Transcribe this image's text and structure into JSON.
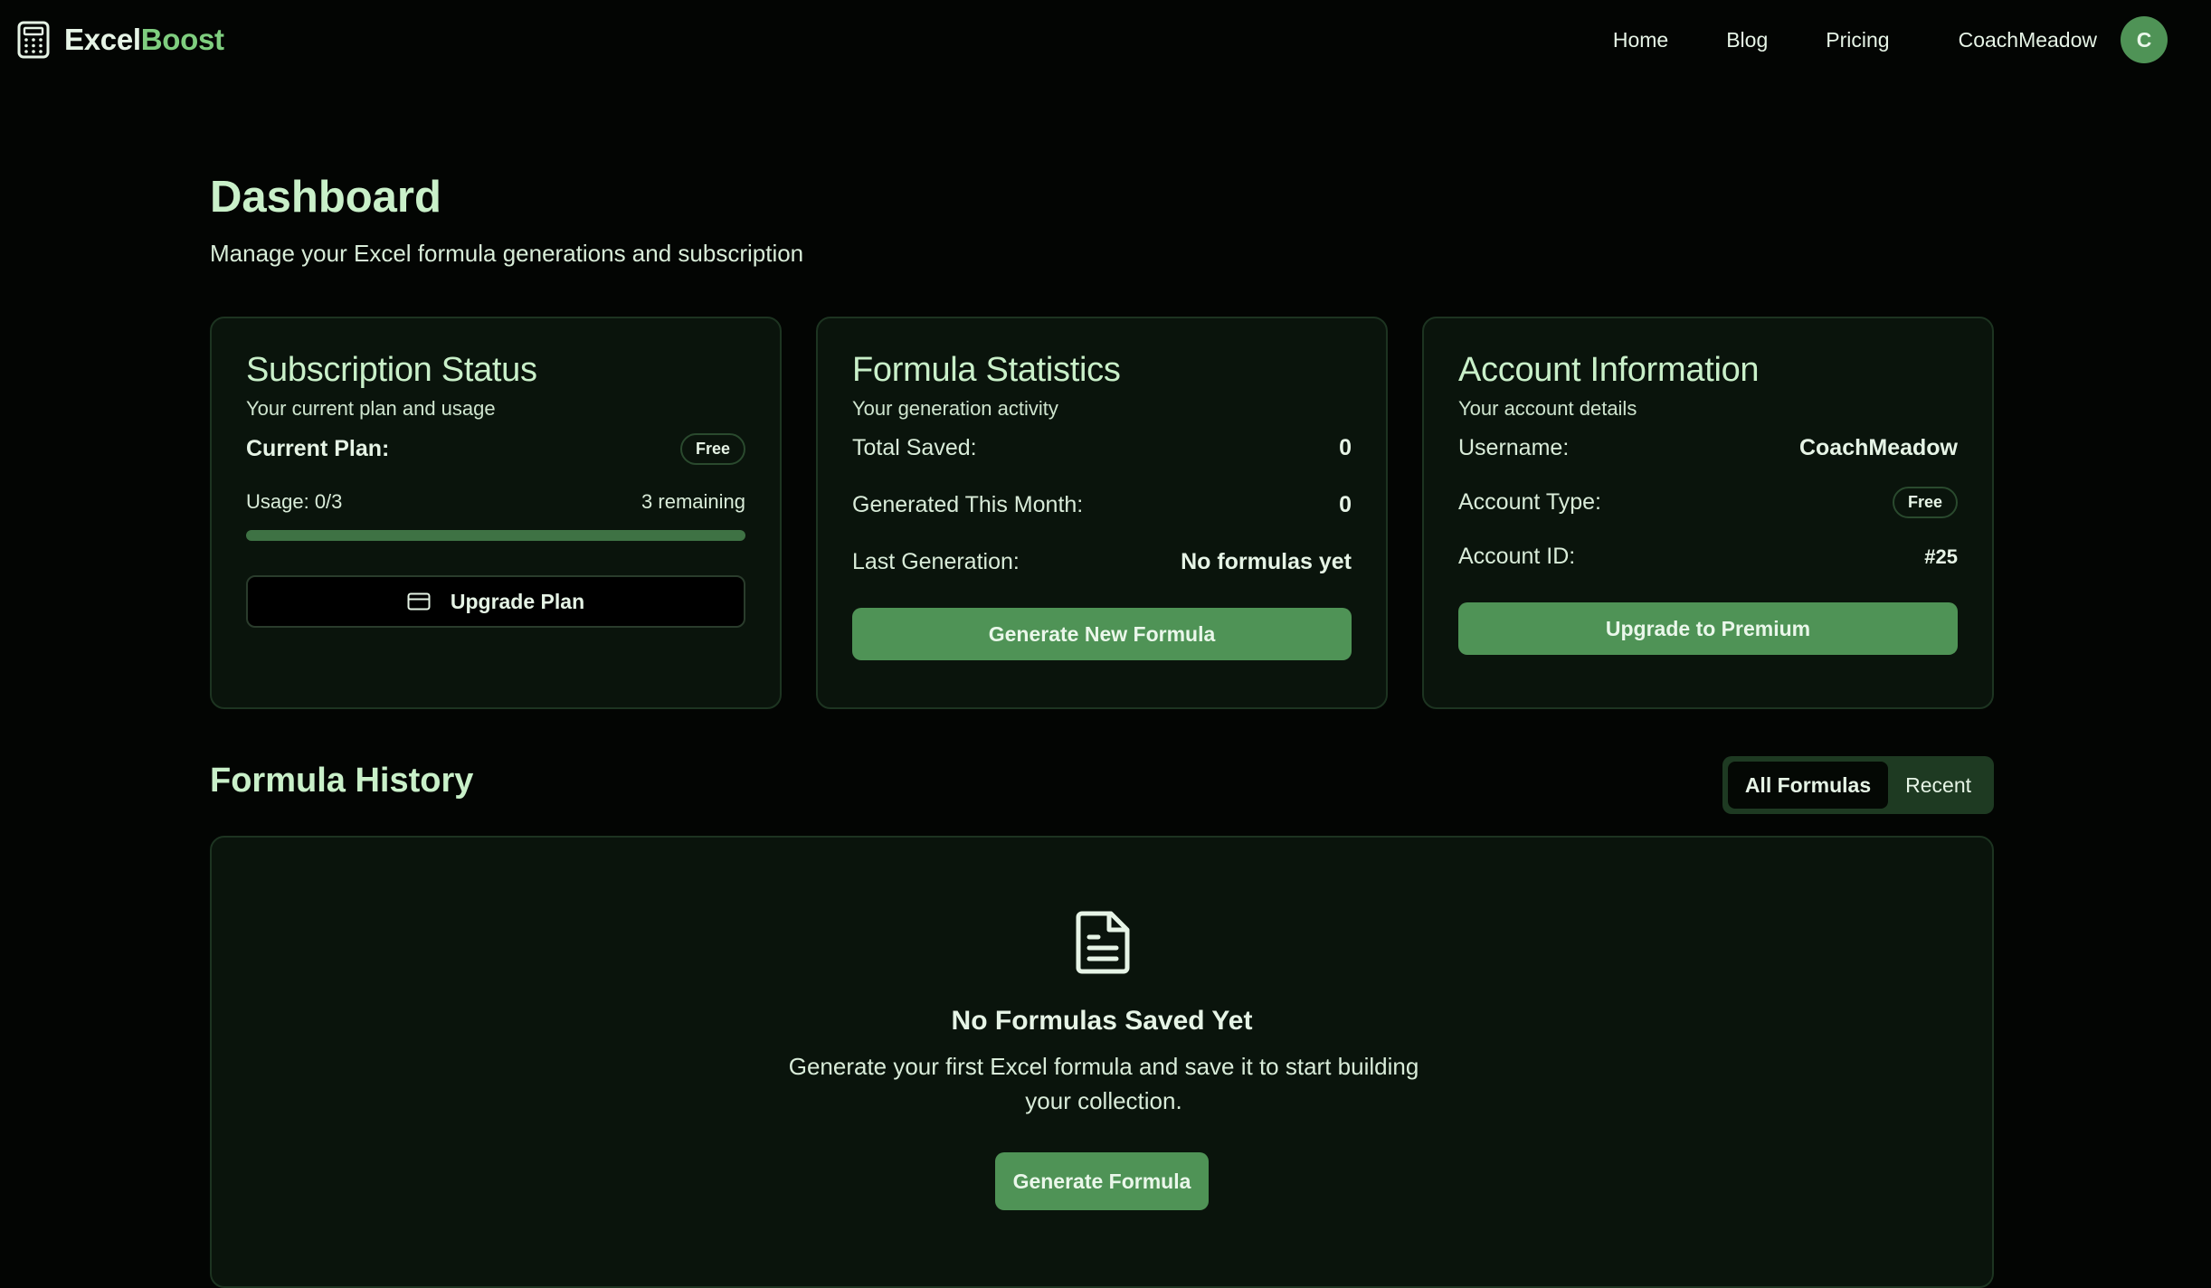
{
  "navbar": {
    "brand_part1": "Excel",
    "brand_part2": "Boost",
    "brand_icon": "calculator-icon",
    "links": [
      "Home",
      "Blog",
      "Pricing"
    ],
    "username": "CoachMeadow",
    "avatar_initial": "C"
  },
  "page": {
    "title": "Dashboard",
    "subtitle": "Manage your Excel formula generations and subscription"
  },
  "subscription": {
    "title": "Subscription Status",
    "description": "Your current plan and usage",
    "plan_label": "Current Plan:",
    "plan_value": "Free",
    "usage_label": "Usage: 0/3",
    "remaining": "3 remaining",
    "usage_fraction": 0,
    "upgrade_button": "Upgrade Plan",
    "upgrade_icon": "credit-card-icon"
  },
  "stats": {
    "title": "Formula Statistics",
    "description": "Your generation activity",
    "rows": [
      {
        "label": "Total Saved:",
        "value": "0"
      },
      {
        "label": "Generated This Month:",
        "value": "0"
      },
      {
        "label": "Last Generation:",
        "value": "No formulas yet"
      }
    ],
    "button": "Generate New Formula"
  },
  "account": {
    "title": "Account Information",
    "description": "Your account details",
    "username_label": "Username:",
    "username_value": "CoachMeadow",
    "type_label": "Account Type:",
    "type_value": "Free",
    "id_label": "Account ID:",
    "id_value": "#25",
    "button": "Upgrade to Premium"
  },
  "history": {
    "title": "Formula History",
    "tabs": [
      "All Formulas",
      "Recent"
    ],
    "active_tab": "All Formulas",
    "empty_icon": "file-text-icon",
    "empty_title": "No Formulas Saved Yet",
    "empty_description": "Generate your first Excel formula and save it to start building your collection.",
    "empty_button": "Generate Formula"
  },
  "colors": {
    "background": "#030503",
    "card": "#0a140c",
    "accent": "#4f9356",
    "accent_light": "#7fce7f",
    "heading": "#c9f0c9"
  }
}
